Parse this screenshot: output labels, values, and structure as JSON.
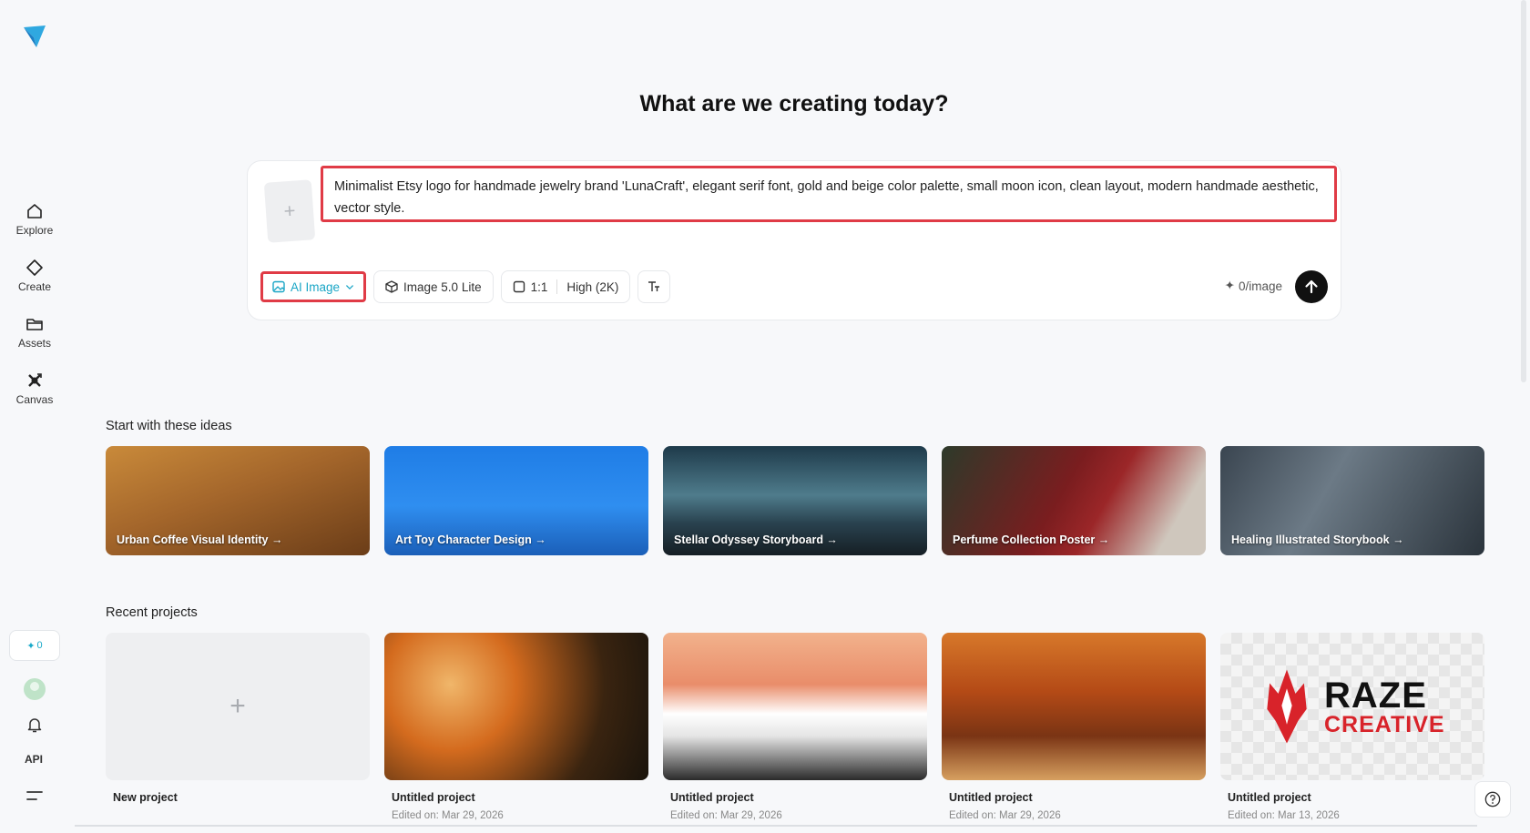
{
  "sidebar": {
    "items": [
      {
        "label": "Explore",
        "icon": "home-icon"
      },
      {
        "label": "Create",
        "icon": "diamond-icon"
      },
      {
        "label": "Assets",
        "icon": "folder-icon"
      },
      {
        "label": "Canvas",
        "icon": "canvas-icon"
      }
    ],
    "credits": "0",
    "api_label": "API"
  },
  "main": {
    "headline": "What are we creating today?",
    "prompt": {
      "text": "Minimalist Etsy logo for handmade jewelry brand 'LunaCraft', elegant serif font, gold and beige color palette, small moon icon, clean layout, modern handmade aesthetic, vector style."
    },
    "toolbar": {
      "mode": "AI Image",
      "model": "Image 5.0 Lite",
      "ratio": "1:1",
      "quality": "High (2K)",
      "credits": "0/image"
    },
    "ideas_title": "Start with these ideas",
    "ideas": [
      {
        "label": "Urban Coffee Visual Identity →"
      },
      {
        "label": "Art Toy Character Design →"
      },
      {
        "label": "Stellar Odyssey Storyboard →"
      },
      {
        "label": "Perfume Collection Poster →"
      },
      {
        "label": "Healing Illustrated Storybook →"
      }
    ],
    "recent_title": "Recent projects",
    "new_project_label": "New project",
    "projects": [
      {
        "name": "Untitled project",
        "date": "Edited on: Mar 29, 2026"
      },
      {
        "name": "Untitled project",
        "date": "Edited on: Mar 29, 2026"
      },
      {
        "name": "Untitled project",
        "date": "Edited on: Mar 29, 2026"
      },
      {
        "name": "Untitled project",
        "date": "Edited on: Mar 13, 2026"
      }
    ],
    "raze_logo": {
      "line1": "RAZE",
      "line2": "CREATIVE"
    }
  },
  "colors": {
    "accent": "#1aa6c6",
    "highlight": "#e03b46",
    "send_button": "#111111"
  }
}
